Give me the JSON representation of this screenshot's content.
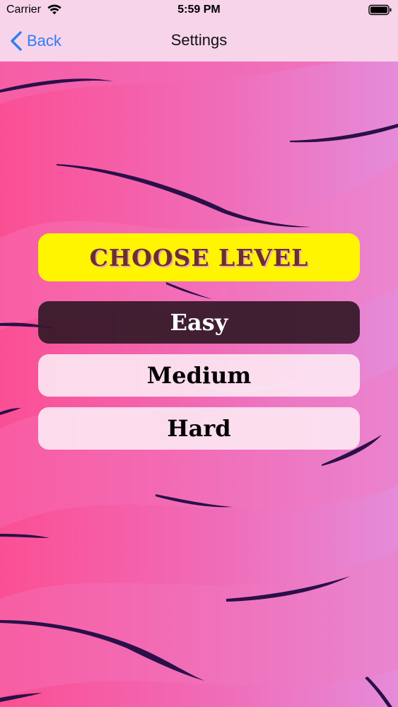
{
  "status_bar": {
    "carrier": "Carrier",
    "time": "5:59 PM",
    "icons": [
      "wifi-icon",
      "battery-icon"
    ]
  },
  "nav": {
    "back_label": "Back",
    "title": "Settings"
  },
  "main": {
    "heading": "CHOOSE LEVEL",
    "levels": [
      {
        "label": "Easy",
        "selected": true
      },
      {
        "label": "Medium",
        "selected": false
      },
      {
        "label": "Hard",
        "selected": false
      }
    ]
  },
  "colors": {
    "heading_bg": "#fff500",
    "heading_text": "#6b2f2f",
    "selected_bg": "#341928",
    "unselected_bg": "#fce6f2",
    "back_accent": "#2f7df6",
    "bar_bg": "#f7d4ea",
    "background_left": "#fb4f94",
    "background_right": "#e78ad8"
  }
}
